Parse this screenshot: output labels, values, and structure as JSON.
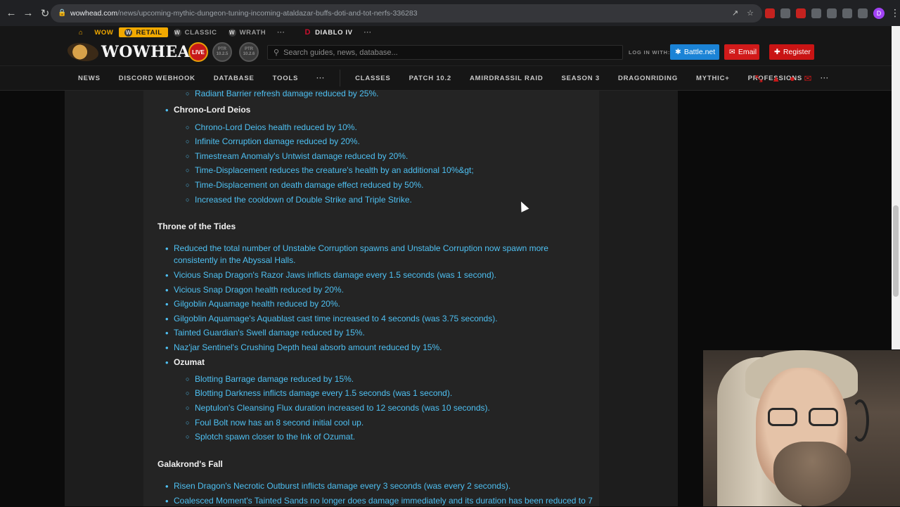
{
  "browser": {
    "url_host": "wowhead.com",
    "url_path": "/news/upcoming-mythic-dungeon-tuning-incoming-ataldazar-buffs-doti-and-tot-nerfs-336283",
    "profile_initial": "D"
  },
  "site_top": {
    "wow": "WOW",
    "retail": "RETAIL",
    "classic": "CLASSIC",
    "wrath": "WRATH",
    "more": "···",
    "diablo": "DIABLO IV",
    "more2": "···"
  },
  "header": {
    "logo": "WOWHEAD",
    "live": "LIVE",
    "ptr1": [
      "PTR",
      "10.2.5"
    ],
    "ptr2": [
      "PTR",
      "10.2.6"
    ],
    "search_placeholder": "Search guides, news, database...",
    "login_label": "LOG IN WITH:",
    "bnet": "Battle.net",
    "email": "Email",
    "register": "Register"
  },
  "menu": {
    "items": [
      "NEWS",
      "DISCORD WEBHOOK",
      "DATABASE",
      "TOOLS",
      "···",
      "CLASSES",
      "PATCH 10.2",
      "AMIRDRASSIL RAID",
      "SEASON 3",
      "DRAGONRIDING",
      "MYTHIC+",
      "PROFESSIONS",
      "···"
    ]
  },
  "article": {
    "prev_item": "Radiant Barrier refresh damage reduced by 25%.",
    "boss1": "Chrono-Lord Deios",
    "boss1_items": [
      "Chrono-Lord Deios health reduced by 10%.",
      "Infinite Corruption damage reduced by 20%.",
      "Timestream Anomaly's Untwist damage reduced by 20%.",
      "Time-Displacement reduces the creature's health by an additional 10%&gt;",
      "Time-Displacement on death damage effect reduced by 50%.",
      "Increased the cooldown of Double Strike and Triple Strike."
    ],
    "section2": "Throne of the Tides",
    "section2_items": [
      "Reduced the total number of Unstable Corruption spawns and Unstable Corruption now spawn more consistently in the Abyssal Halls.",
      "Vicious Snap Dragon's Razor Jaws inflicts damage every 1.5 seconds (was 1 second).",
      "Vicious Snap Dragon health reduced by 20%.",
      "Gilgoblin Aquamage health reduced by 20%.",
      "Gilgoblin Aquamage's Aquablast cast time increased to 4 seconds (was 3.75 seconds).",
      "Tainted Guardian's Swell damage reduced by 15%.",
      "Naz'jar Sentinel's Crushing Depth heal absorb amount reduced by 15%."
    ],
    "boss2": "Ozumat",
    "boss2_items": [
      "Blotting Barrage damage reduced by 15%.",
      "Blotting Darkness inflicts damage every 1.5 seconds (was 1 second).",
      "Neptulon's Cleansing Flux duration increased to 12 seconds (was 10 seconds).",
      "Foul Bolt now has an 8 second initial cool up.",
      "Splotch spawn closer to the Ink of Ozumat."
    ],
    "section3": "Galakrond's Fall",
    "section3_items": [
      "Risen Dragon's Necrotic Outburst inflicts damage every 3 seconds (was every 2 seconds).",
      "Coalesced Moment's Tainted Sands no longer does damage immediately and its duration has been reduced to 7"
    ]
  }
}
